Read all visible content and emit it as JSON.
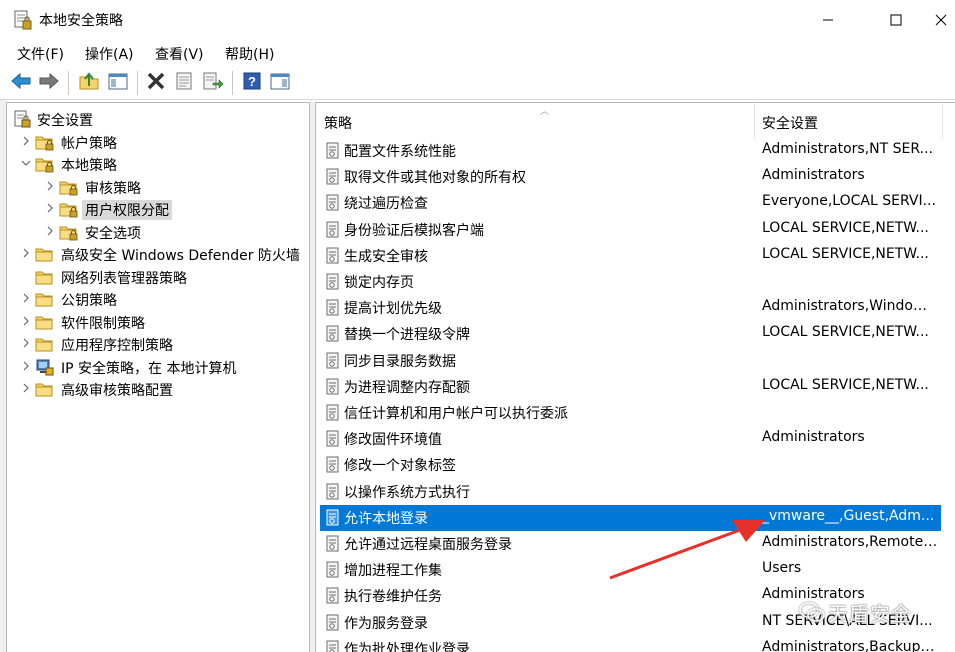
{
  "window": {
    "title": "本地安全策略",
    "icons": {
      "app": "security-policy-icon",
      "minimize": "minimize-icon",
      "maximize": "maximize-icon",
      "close": "close-icon"
    }
  },
  "menu": [
    {
      "label": "文件(F)"
    },
    {
      "label": "操作(A)"
    },
    {
      "label": "查看(V)"
    },
    {
      "label": "帮助(H)"
    }
  ],
  "toolbar": [
    "back-arrow-icon",
    "forward-arrow-icon",
    "up-folder-icon",
    "show-hide-tree-icon",
    "delete-icon",
    "properties-icon",
    "export-list-icon",
    "help-icon",
    "show-hide-action-pane-icon"
  ],
  "tree": {
    "items": [
      {
        "label": "安全设置",
        "icon": "security-settings-icon",
        "level": 0,
        "chevron": ""
      },
      {
        "label": "帐户策略",
        "icon": "folder-lock-icon",
        "level": 1,
        "chevron": "right"
      },
      {
        "label": "本地策略",
        "icon": "folder-lock-icon",
        "level": 1,
        "chevron": "down"
      },
      {
        "label": "审核策略",
        "icon": "folder-lock-icon",
        "level": 2,
        "chevron": "right"
      },
      {
        "label": "用户权限分配",
        "icon": "folder-lock-icon",
        "level": 2,
        "chevron": "right",
        "selected": true
      },
      {
        "label": "安全选项",
        "icon": "folder-lock-icon",
        "level": 2,
        "chevron": "right"
      },
      {
        "label": "高级安全 Windows Defender 防火墙",
        "icon": "folder-icon",
        "level": 1,
        "chevron": "right"
      },
      {
        "label": "网络列表管理器策略",
        "icon": "folder-icon",
        "level": 1,
        "chevron": ""
      },
      {
        "label": "公钥策略",
        "icon": "folder-icon",
        "level": 1,
        "chevron": "right"
      },
      {
        "label": "软件限制策略",
        "icon": "folder-icon",
        "level": 1,
        "chevron": "right"
      },
      {
        "label": "应用程序控制策略",
        "icon": "folder-icon",
        "level": 1,
        "chevron": "right"
      },
      {
        "label": "IP 安全策略，在 本地计算机",
        "icon": "ip-security-icon",
        "level": 1,
        "chevron": "right"
      },
      {
        "label": "高级审核策略配置",
        "icon": "folder-icon",
        "level": 1,
        "chevron": "right"
      }
    ]
  },
  "list": {
    "columns": [
      {
        "label": "策略"
      },
      {
        "label": "安全设置"
      }
    ],
    "rows": [
      {
        "policy": "配置文件系统性能",
        "setting": "Administrators,NT SER..."
      },
      {
        "policy": "取得文件或其他对象的所有权",
        "setting": "Administrators"
      },
      {
        "policy": "绕过遍历检查",
        "setting": "Everyone,LOCAL SERVI..."
      },
      {
        "policy": "身份验证后模拟客户端",
        "setting": "LOCAL SERVICE,NETW..."
      },
      {
        "policy": "生成安全审核",
        "setting": "LOCAL SERVICE,NETW..."
      },
      {
        "policy": "锁定内存页",
        "setting": ""
      },
      {
        "policy": "提高计划优先级",
        "setting": "Administrators,Window ..."
      },
      {
        "policy": "替换一个进程级令牌",
        "setting": "LOCAL SERVICE,NETW..."
      },
      {
        "policy": "同步目录服务数据",
        "setting": ""
      },
      {
        "policy": "为进程调整内存配额",
        "setting": "LOCAL SERVICE,NETW..."
      },
      {
        "policy": "信任计算机和用户帐户可以执行委派",
        "setting": ""
      },
      {
        "policy": "修改固件环境值",
        "setting": "Administrators"
      },
      {
        "policy": "修改一个对象标签",
        "setting": ""
      },
      {
        "policy": "以操作系统方式执行",
        "setting": ""
      },
      {
        "policy": "允许本地登录",
        "setting": "_vmware__,Guest,Adm...",
        "selected": true
      },
      {
        "policy": "允许通过远程桌面服务登录",
        "setting": "Administrators,Remote ..."
      },
      {
        "policy": "增加进程工作集",
        "setting": "Users"
      },
      {
        "policy": "执行卷维护任务",
        "setting": "Administrators"
      },
      {
        "policy": "作为服务登录",
        "setting": "NT SERVICE\\ALL SERVI..."
      },
      {
        "policy": "作为批处理作业登录",
        "setting": "Administrators,Backup ..."
      }
    ],
    "row_icon": "policy-item-icon"
  },
  "annotation": {
    "arrow_color": "#e8302a",
    "arrow_icon": "red-arrow-icon"
  },
  "watermark": {
    "text": "天盾安全",
    "icon": "wechat-icon"
  },
  "colors": {
    "selection": "#0078d7",
    "tree_selection": "#d9d9d9",
    "folder": "#f5d36b"
  }
}
